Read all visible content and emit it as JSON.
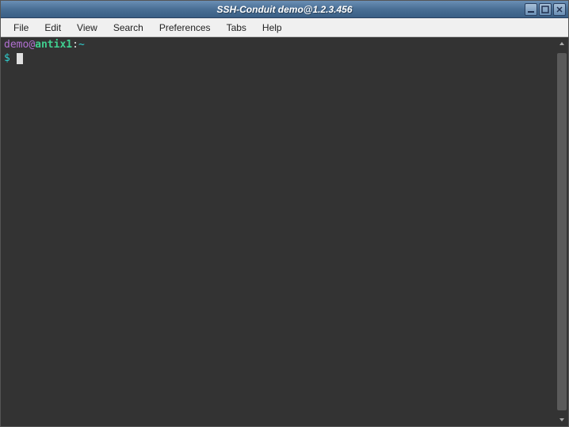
{
  "window": {
    "title": "SSH-Conduit  demo@1.2.3.456"
  },
  "menubar": {
    "items": [
      "File",
      "Edit",
      "View",
      "Search",
      "Preferences",
      "Tabs",
      "Help"
    ]
  },
  "terminal": {
    "prompt": {
      "user": "demo",
      "at": "@",
      "host": "antix1",
      "colon": ":",
      "path": "~",
      "symbol": "$ "
    }
  }
}
